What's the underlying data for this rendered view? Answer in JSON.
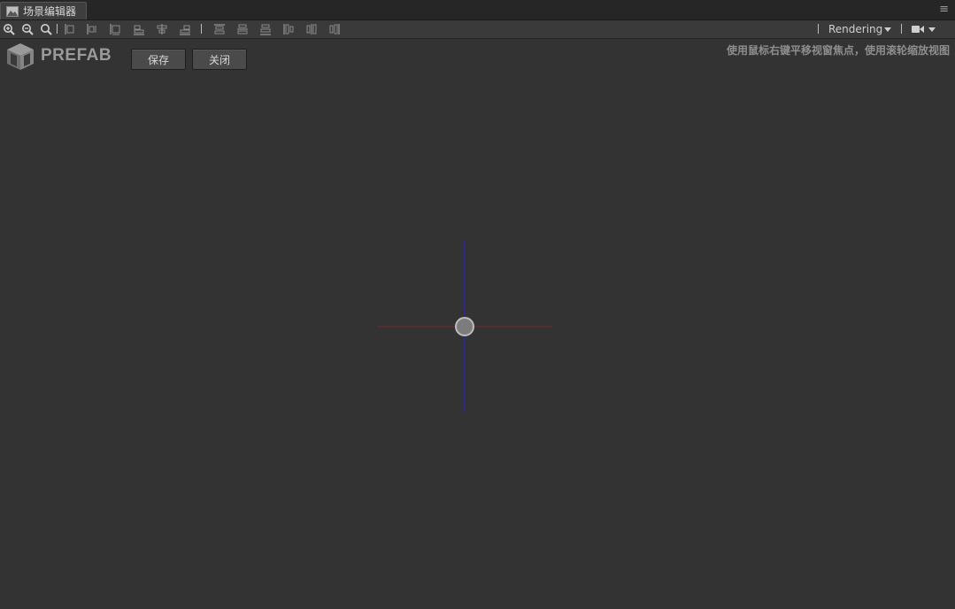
{
  "tab": {
    "title": "场景编辑器",
    "icon": "landscape-icon",
    "menu_icon": "≡"
  },
  "toolbar": {
    "zoom_tools": [
      "zoom-in-icon",
      "zoom-out-icon",
      "zoom-reset-icon"
    ],
    "align_tools": [
      "align-left-icon",
      "align-hcenter-icon",
      "align-right-icon",
      "align-top-edge-icon",
      "align-vcenter-icon",
      "align-bottom-edge-icon",
      "distribute-top-icon",
      "distribute-vcenter-icon",
      "distribute-bottom-icon",
      "distribute-left-icon",
      "distribute-hcenter-icon",
      "distribute-right-icon"
    ],
    "rendering_label": "Rendering",
    "camera_icon": "camera-icon"
  },
  "header": {
    "logo_text": "PREFAB",
    "save_label": "保存",
    "close_label": "关闭",
    "hint": "使用鼠标右键平移视窗焦点，使用滚轮缩放视图"
  },
  "colors": {
    "background": "#333333",
    "x_axis": "#8a2a2a",
    "y_axis": "#2a2a8a",
    "origin_handle": "#9a9a9a"
  }
}
